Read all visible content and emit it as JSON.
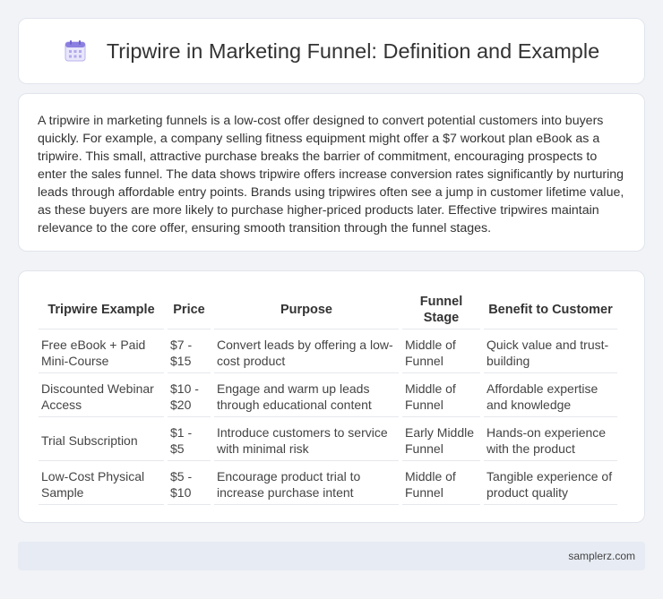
{
  "header": {
    "title": "Tripwire in Marketing Funnel: Definition and Example",
    "icon": "calendar-icon"
  },
  "description": "A tripwire in marketing funnels is a low-cost offer designed to convert potential customers into buyers quickly. For example, a company selling fitness equipment might offer a $7 workout plan eBook as a tripwire. This small, attractive purchase breaks the barrier of commitment, encouraging prospects to enter the sales funnel. The data shows tripwire offers increase conversion rates significantly by nurturing leads through affordable entry points. Brands using tripwires often see a jump in customer lifetime value, as these buyers are more likely to purchase higher-priced products later. Effective tripwires maintain relevance to the core offer, ensuring smooth transition through the funnel stages.",
  "table": {
    "headers": [
      "Tripwire Example",
      "Price",
      "Purpose",
      "Funnel Stage",
      "Benefit to Customer"
    ],
    "rows": [
      [
        "Free eBook + Paid Mini-Course",
        "$7 - $15",
        "Convert leads by offering a low-cost product",
        "Middle of Funnel",
        "Quick value and trust-building"
      ],
      [
        "Discounted Webinar Access",
        "$10 - $20",
        "Engage and warm up leads through educational content",
        "Middle of Funnel",
        "Affordable expertise and knowledge"
      ],
      [
        "Trial Subscription",
        "$1 - $5",
        "Introduce customers to service with minimal risk",
        "Early Middle Funnel",
        "Hands-on experience with the product"
      ],
      [
        "Low-Cost Physical Sample",
        "$5 - $10",
        "Encourage product trial to increase purchase intent",
        "Middle of Funnel",
        "Tangible experience of product quality"
      ]
    ]
  },
  "footer": {
    "site": "samplerz.com"
  },
  "colors": {
    "background": "#f1f3f7",
    "card": "#ffffff",
    "footer": "#e7ebf3",
    "icon_accent": "#8b7fe0"
  }
}
